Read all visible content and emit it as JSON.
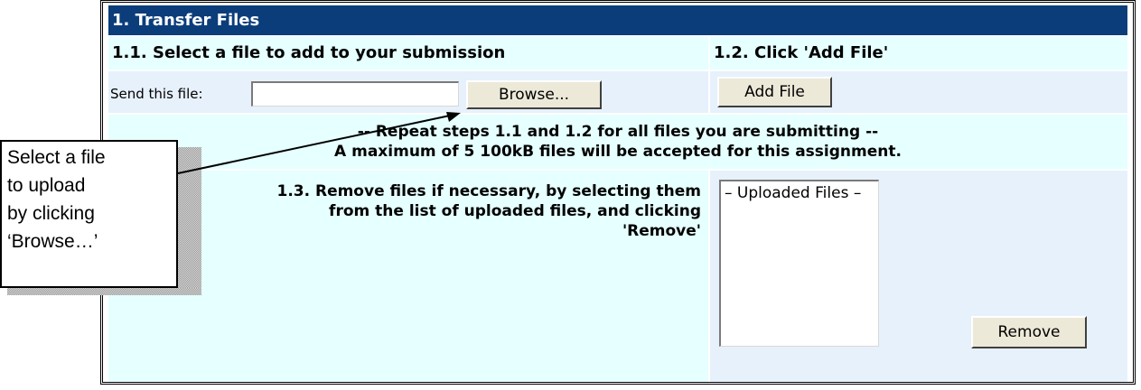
{
  "section": {
    "title": "1. Transfer Files"
  },
  "step_select": {
    "heading": "1.1. Select a file to add to your submission",
    "send_label": "Send this file:",
    "file_input_value": "",
    "browse_button": "Browse..."
  },
  "step_add": {
    "heading": "1.2. Click 'Add File'",
    "add_button": "Add File"
  },
  "repeat_note": {
    "line1": "-- Repeat steps 1.1 and 1.2 for all files you are submitting --",
    "line2": "A maximum of 5 100kB files will be accepted for this assignment."
  },
  "step_remove": {
    "text_line1": "1.3. Remove files if necessary, by selecting them",
    "text_line2": "from the list of uploaded files, and clicking",
    "text_line3": "'Remove'",
    "list_header": "– Uploaded Files –",
    "remove_button": "Remove"
  },
  "callout": {
    "line1": "Select a file",
    "line2": "to upload",
    "line3": "by clicking",
    "line4": "‘Browse…’"
  },
  "colors": {
    "title_bar": "#0b3d7b",
    "cyan_row": "#e6ffff",
    "blue_row": "#e7f1fc",
    "button_face": "#ece9d8"
  }
}
